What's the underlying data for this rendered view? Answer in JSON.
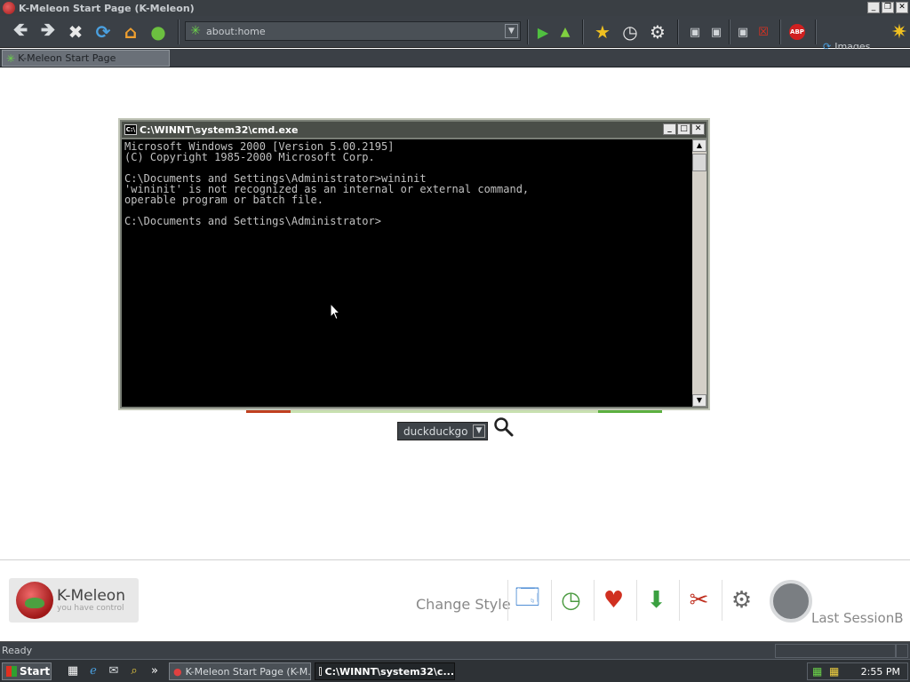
{
  "window": {
    "title": "K-Meleon Start Page (K-Meleon)",
    "controls": [
      "minimize",
      "restore",
      "close"
    ]
  },
  "toolbar": {
    "nav_icons": [
      "back-icon",
      "forward-icon",
      "stop-icon",
      "reload-icon",
      "home-icon",
      "globe-icon"
    ],
    "url": "about:home",
    "go_icons": [
      "go-icon",
      "up-icon"
    ],
    "tool_icons": [
      "bookmark-star-icon",
      "history-clock-icon",
      "settings-gear-icon"
    ],
    "layout_icons": [
      "window-1-icon",
      "window-2-icon",
      "window-3-icon",
      "window-close-icon"
    ],
    "adblock_label": "ABP",
    "images_label": "Images"
  },
  "tab": {
    "label": "K-Meleon Start Page"
  },
  "cmd": {
    "title": "C:\\WINNT\\system32\\cmd.exe",
    "icon_label": "C:\\",
    "lines": [
      "Microsoft Windows 2000 [Version 5.00.2195]",
      "(C) Copyright 1985-2000 Microsoft Corp.",
      "",
      "C:\\Documents and Settings\\Administrator>wininit",
      "'wininit' is not recognized as an internal or external command,",
      "operable program or batch file.",
      "",
      "C:\\Documents and Settings\\Administrator>"
    ]
  },
  "search": {
    "engine": "duckduckgo"
  },
  "bottom": {
    "logo_name": "K-Meleon",
    "logo_tagline": "you have control",
    "change_style_label": "Change Style",
    "tools": [
      "new-window-icon",
      "history-icon",
      "favorites-heart-icon",
      "download-icon",
      "tools-icon",
      "settings-icon"
    ],
    "last_session_label": "Last SessionB"
  },
  "status": {
    "text": "Ready"
  },
  "taskbar": {
    "start_label": "Start",
    "quicklaunch": [
      "desktop-icon",
      "ie-icon",
      "outlook-icon",
      "search-icon"
    ],
    "more_label": "»",
    "tasks": [
      {
        "label": "K-Meleon Start Page (K-M...",
        "active": false
      },
      {
        "label": "C:\\WINNT\\system32\\c...",
        "active": true
      }
    ],
    "clock": "2:55 PM"
  }
}
